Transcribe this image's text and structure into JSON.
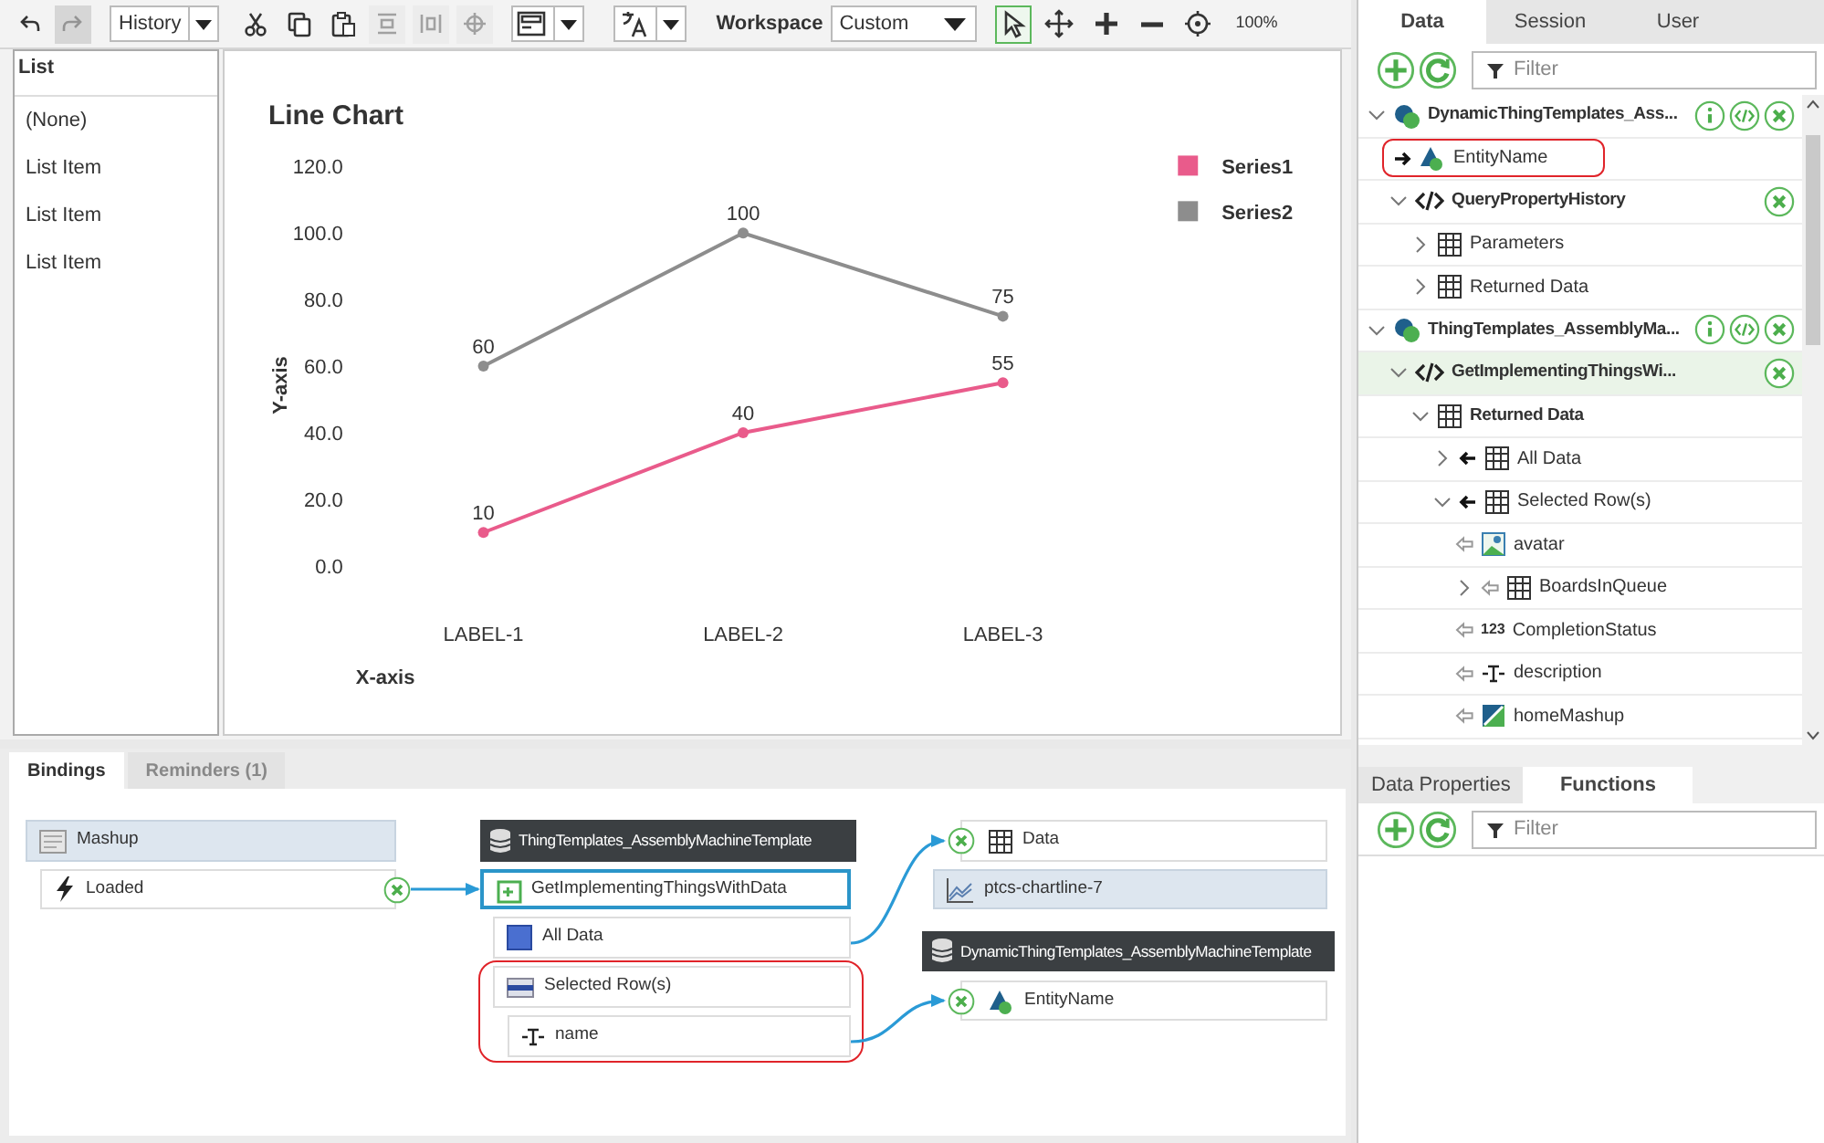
{
  "toolbar": {
    "items": [
      {
        "kind": "tool",
        "disabled": false,
        "selected": false
      },
      {
        "kind": "tool",
        "disabled": true,
        "selected": true
      },
      {
        "kind": "dropdown",
        "label": "History"
      },
      {
        "kind": "tool",
        "disabled": false,
        "selected": false
      },
      {
        "kind": "tool",
        "disabled": false,
        "selected": false
      },
      {
        "kind": "tool",
        "disabled": false,
        "selected": false
      },
      {
        "kind": "tool",
        "disabled": true,
        "selected": false
      },
      {
        "kind": "tool",
        "disabled": true,
        "selected": false
      },
      {
        "kind": "tool",
        "disabled": true,
        "selected": false
      },
      {
        "kind": "dropdown"
      },
      {
        "kind": "dropdown"
      },
      {
        "kind": "label",
        "text": "Workspace"
      },
      {
        "kind": "select",
        "value": "Custom"
      },
      {
        "kind": "tool",
        "disabled": false,
        "selected": true
      },
      {
        "kind": "tool",
        "disabled": false,
        "selected": false
      },
      {
        "kind": "tool",
        "disabled": false,
        "selected": false
      },
      {
        "kind": "tool",
        "disabled": false,
        "selected": false
      },
      {
        "kind": "tool",
        "disabled": false,
        "selected": false
      },
      {
        "kind": "text",
        "text": "100%"
      }
    ]
  },
  "list_widget": {
    "title": "List",
    "items": [
      "(None)",
      "List Item",
      "List Item",
      "List Item"
    ]
  },
  "chart": {
    "chart_data": {
      "type": "line",
      "title": "Line Chart",
      "xlabel": "X-axis",
      "ylabel": "Y-axis",
      "categories": [
        "LABEL-1",
        "LABEL-2",
        "LABEL-3"
      ],
      "ylim": [
        0,
        120
      ],
      "yticks": [
        {
          "value": 0,
          "label": "0.0"
        },
        {
          "value": 20,
          "label": "20.0"
        },
        {
          "value": 40,
          "label": "40.0"
        },
        {
          "value": 60,
          "label": "60.0"
        },
        {
          "value": 80,
          "label": "80.0"
        },
        {
          "value": 100,
          "label": "100.0"
        },
        {
          "value": 120,
          "label": "120.0"
        }
      ],
      "data_labels": true,
      "legend": "top-right",
      "series": [
        {
          "name": "Series1",
          "color": "#e95b8b",
          "marker": "circle",
          "values": [
            10,
            40,
            55
          ]
        },
        {
          "name": "Series2",
          "color": "#8d8d8d",
          "marker": "circle",
          "values": [
            60,
            100,
            75
          ]
        }
      ]
    }
  },
  "bindings": {
    "tabs": [
      {
        "label": "Bindings",
        "selected": true
      },
      {
        "label": "Reminders (1)",
        "selected": false
      }
    ],
    "nodes": [
      {
        "kind": "widget",
        "label": "Mashup",
        "selected": false,
        "removable": false
      },
      {
        "kind": "item",
        "label": "Loaded",
        "selected": false,
        "removable": true
      },
      {
        "kind": "source",
        "label": "ThingTemplates_AssemblyMachineTemplate",
        "selected": false,
        "removable": false
      },
      {
        "kind": "item",
        "label": "GetImplementingThingsWithData",
        "selected": true,
        "removable": false
      },
      {
        "kind": "item",
        "label": "All Data",
        "selected": false,
        "removable": false
      },
      {
        "kind": "item",
        "label": "Selected Row(s)",
        "selected": false,
        "removable": false,
        "highlighted": true
      },
      {
        "kind": "item",
        "label": "name",
        "selected": false,
        "removable": false,
        "highlighted": true
      },
      {
        "kind": "item",
        "label": "Data",
        "selected": false,
        "removable": true
      },
      {
        "kind": "widget",
        "label": "ptcs-chartline-7",
        "selected": false,
        "removable": false
      },
      {
        "kind": "source",
        "label": "DynamicThingTemplates_AssemblyMachineTemplate",
        "selected": false,
        "removable": false
      },
      {
        "kind": "item",
        "label": "EntityName",
        "selected": false,
        "removable": true
      }
    ]
  },
  "data_panel": {
    "tabs": [
      {
        "label": "Data",
        "selected": true
      },
      {
        "label": "Session",
        "selected": false
      },
      {
        "label": "User",
        "selected": false
      }
    ],
    "filter": {
      "placeholder": "Filter"
    },
    "tree": [
      {
        "label": "DynamicThingTemplates_Ass...",
        "kind": "thing",
        "expanded": true,
        "selected": false,
        "highlighted": false,
        "children": [
          {
            "label": "EntityName",
            "kind": "entity",
            "selected": false,
            "highlighted": true
          },
          {
            "label": "QueryPropertyHistory",
            "kind": "service",
            "expanded": true,
            "selected": false,
            "highlighted": false,
            "children": [
              {
                "label": "Parameters",
                "kind": "table",
                "expanded": false,
                "selected": false,
                "highlighted": false
              },
              {
                "label": "Returned Data",
                "kind": "table",
                "expanded": false,
                "selected": false,
                "highlighted": false
              }
            ]
          }
        ]
      },
      {
        "label": "ThingTemplates_AssemblyMa...",
        "kind": "thing",
        "expanded": true,
        "selected": false,
        "highlighted": false,
        "children": [
          {
            "label": "GetImplementingThingsWi...",
            "kind": "service",
            "expanded": true,
            "selected": true,
            "highlighted": false,
            "children": [
              {
                "label": "Returned Data",
                "kind": "table",
                "expanded": true,
                "selected": false,
                "highlighted": false,
                "children": [
                  {
                    "label": "All Data",
                    "kind": "table",
                    "expanded": false,
                    "selected": false,
                    "highlighted": false
                  },
                  {
                    "label": "Selected Row(s)",
                    "kind": "table",
                    "expanded": true,
                    "selected": false,
                    "highlighted": false,
                    "children": [
                      {
                        "label": "avatar",
                        "kind": "image",
                        "selected": false,
                        "highlighted": false
                      },
                      {
                        "label": "BoardsInQueue",
                        "kind": "table",
                        "expanded": false,
                        "selected": false,
                        "highlighted": false
                      },
                      {
                        "label": "CompletionStatus",
                        "kind": "number",
                        "type_label": "123",
                        "selected": false,
                        "highlighted": false
                      },
                      {
                        "label": "description",
                        "kind": "text",
                        "selected": false,
                        "highlighted": false
                      },
                      {
                        "label": "homeMashup",
                        "kind": "mashup",
                        "selected": false,
                        "highlighted": false
                      }
                    ]
                  }
                ]
              }
            ]
          }
        ]
      }
    ]
  },
  "functions_panel": {
    "tabs": [
      {
        "label": "Data Properties",
        "selected": false
      },
      {
        "label": "Functions",
        "selected": true
      }
    ],
    "filter": {
      "placeholder": "Filter"
    }
  }
}
